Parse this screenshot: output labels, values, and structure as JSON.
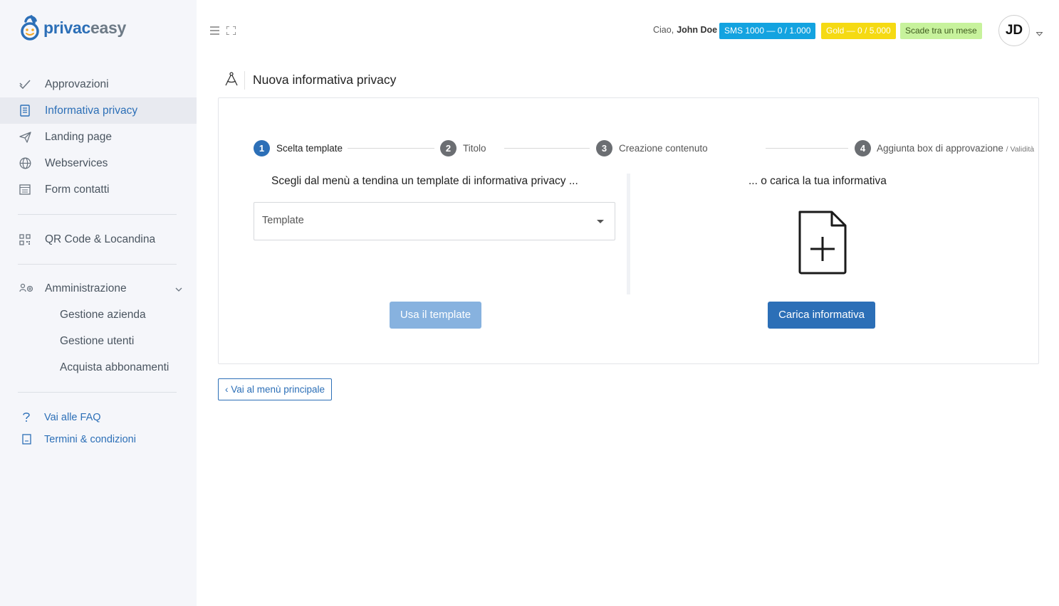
{
  "app": {
    "logo_part1": "privac",
    "logo_part2": "easy"
  },
  "sidebar": {
    "items": [
      {
        "label": "Approvazioni",
        "icon": "check-icon"
      },
      {
        "label": "Informativa privacy",
        "icon": "document-icon",
        "active": true
      },
      {
        "label": "Landing page",
        "icon": "paper-plane-icon"
      },
      {
        "label": "Webservices",
        "icon": "globe-icon"
      },
      {
        "label": "Form contatti",
        "icon": "form-icon"
      },
      {
        "label": "QR Code & Locandina",
        "icon": "qr-code-icon"
      },
      {
        "label": "Amministrazione",
        "icon": "users-gear-icon",
        "expanded": true
      }
    ],
    "admin_sub": [
      {
        "label": "Gestione azienda"
      },
      {
        "label": "Gestione utenti"
      },
      {
        "label": "Acquista abbonamenti"
      }
    ],
    "links": [
      {
        "label": "Vai alle FAQ",
        "icon": "question-icon"
      },
      {
        "label": "Termini & condizioni",
        "icon": "terms-icon"
      }
    ]
  },
  "header": {
    "greeting": "Ciao,",
    "user_name": "John Doe",
    "badges": {
      "sms": "SMS 1000 — 0 / 1.000",
      "gold": "Gold — 0 / 5.000",
      "expiry": "Scade tra un mese"
    },
    "avatar_initials": "JD",
    "colors": {
      "sms": "#13a3e0",
      "gold": "#f5da13",
      "expiry": "#c7f29c",
      "accent": "#2c6fb7"
    }
  },
  "page": {
    "title": "Nuova informativa privacy"
  },
  "stepper": {
    "steps": [
      {
        "num": "1",
        "label": "Scelta template",
        "active": true
      },
      {
        "num": "2",
        "label": "Titolo"
      },
      {
        "num": "3",
        "label": "Creazione contenuto"
      },
      {
        "num": "4",
        "label": "Aggiunta box di approvazione",
        "suffix": "/ Validità"
      }
    ]
  },
  "template_panel": {
    "title": "Scegli dal menù a tendina un template di informativa privacy ...",
    "select_value": "Template",
    "button": "Usa il template"
  },
  "upload_panel": {
    "title": "... o carica la tua informativa",
    "button": "Carica informativa"
  },
  "footer": {
    "back_button": "‹ Vai al menù principale"
  }
}
